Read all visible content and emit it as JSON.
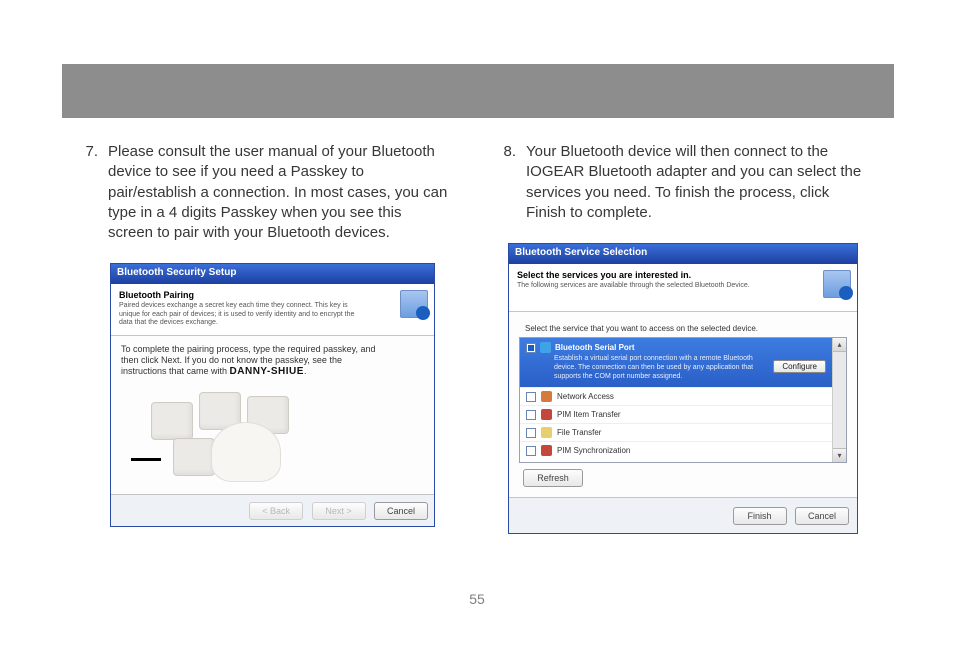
{
  "page_number": "55",
  "steps": {
    "s7": {
      "num": "7.",
      "text": "Please consult the user manual of your Bluetooth device to see if you need a Passkey to pair/establish a connection.  In most cases, you can type in a 4 digits Passkey when you see this screen to pair with your Bluetooth devices."
    },
    "s8": {
      "num": "8.",
      "text": "Your Bluetooth device will then connect to the IOGEAR Bluetooth adapter and you can select the services you need.  To finish the process, click Finish to complete."
    }
  },
  "dlg1": {
    "title": "Bluetooth Security Setup",
    "hdr_title": "Bluetooth Pairing",
    "hdr_sub": "Paired devices exchange a secret key each time they connect. This key is unique for each pair of devices; it is used to verify identity and to encrypt the data that the devices exchange.",
    "body_line1": "To complete the pairing process, type the required passkey, and",
    "body_line2": "then click Next.  If you do not know the passkey, see the",
    "body_line3_prefix": "instructions that came with ",
    "device_name": "DANNY-SHIUE",
    "body_line3_suffix": ".",
    "btn_back": "< Back",
    "btn_next": "Next >",
    "btn_cancel": "Cancel"
  },
  "dlg2": {
    "title": "Bluetooth Service Selection",
    "hdr_title": "Select the services you are interested in.",
    "hdr_sub": "The following services are available through the selected Bluetooth Device.",
    "hint": "Select the service that you want to access on the selected device.",
    "sel_title": "Bluetooth Serial Port",
    "sel_desc": "Establish a virtual serial port connection with a remote Bluetooth device. The connection can then be used by any application that supports the COM port number assigned.",
    "cfg": "Configure",
    "items": [
      "Network Access",
      "PIM Item Transfer",
      "File Transfer",
      "PIM Synchronization"
    ],
    "refresh": "Refresh",
    "btn_finish": "Finish",
    "btn_cancel": "Cancel"
  }
}
